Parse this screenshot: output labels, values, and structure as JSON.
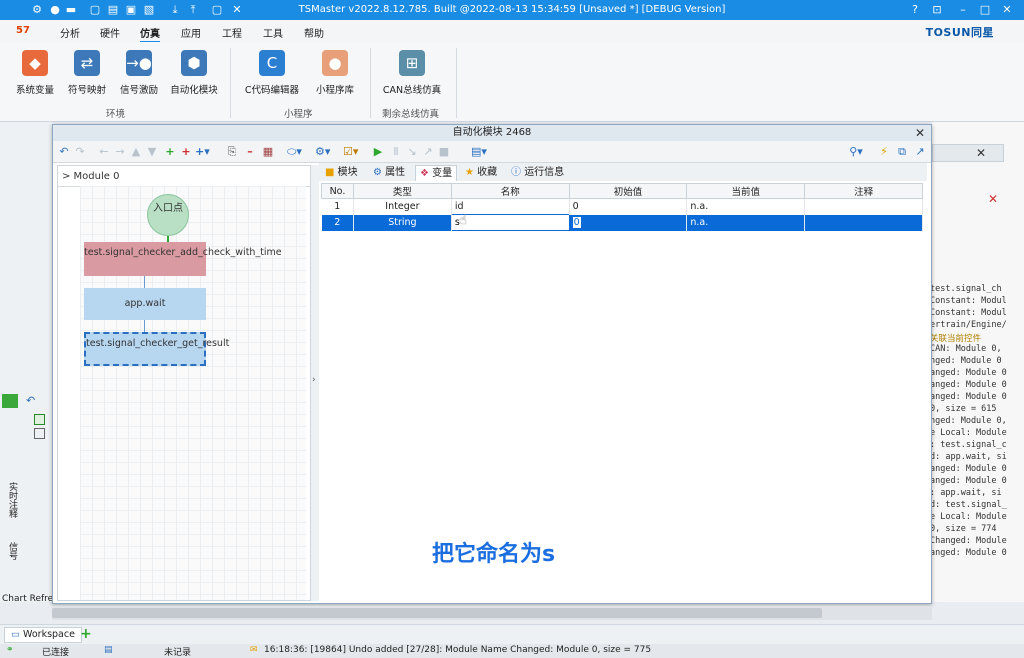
{
  "app": {
    "title": "TSMaster v2022.8.12.785. Built @2022-08-13 15:34:59 [Unsaved *] [DEBUG Version]",
    "brand": "TOSUN同星",
    "app_badge": "57"
  },
  "menu": [
    "分析",
    "硬件",
    "仿真",
    "应用",
    "工程",
    "工具",
    "帮助"
  ],
  "ribbon": {
    "buttons": [
      "系统变量",
      "符号映射",
      "信号激励",
      "自动化模块",
      "C代码编辑器",
      "小程序库",
      "CAN总线仿真"
    ],
    "groups": [
      "环境",
      "小程序",
      "剩余总线仿真"
    ]
  },
  "dialog": {
    "title": "自动化模块 2468",
    "breadcrumb": "> Module 0",
    "tabs": [
      "模块",
      "属性",
      "变量",
      "收藏",
      "运行信息"
    ],
    "flow": {
      "entry": "入口点",
      "n1": "test.signal_checker_add_check_with_time",
      "n2": "app.wait",
      "n3": "test.signal_checker_get_result"
    },
    "grid": {
      "headers": [
        "No.",
        "类型",
        "名称",
        "初始值",
        "当前值",
        "注释"
      ],
      "rows": [
        [
          "1",
          "Integer",
          "id",
          "0",
          "n.a.",
          ""
        ],
        [
          "2",
          "String",
          "s",
          "0",
          "n.a.",
          ""
        ]
      ]
    }
  },
  "caption": "把它命名为s",
  "side_panel": {
    "vertical_labels": [
      "实时注释",
      "信号"
    ],
    "chart_ref": "Chart Refre"
  },
  "log_lines": [
    "test.signal_ch",
    "Constant: Modul",
    "Constant: Modul",
    "ertrain/Engine/",
    "关联当前控件",
    "CAN: Module 0,",
    "nged: Module 0",
    "anged: Module 0",
    "anged: Module 0",
    "anged: Module 0",
    "0, size = 615",
    "nged: Module 0,",
    "e Local: Module",
    ": test.signal_c",
    "d: app.wait, si",
    "anged: Module 0",
    "anged: Module 0",
    ": app.wait, si",
    "d: test.signal_",
    "e Local: Module",
    "0, size = 774",
    "Changed: Module",
    "anged: Module 0"
  ],
  "workspace": {
    "tab": "Workspace"
  },
  "status": {
    "connection": "已连接",
    "record": "未记录",
    "log": "16:18:36: [19864] Undo added [27/28]: Module Name Changed: Module 0, size = 775"
  }
}
